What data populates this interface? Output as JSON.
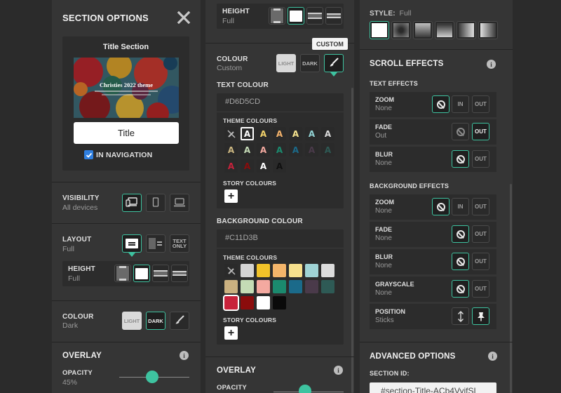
{
  "panel1": {
    "title": "SECTION OPTIONS",
    "preview_caption": "Title Section",
    "preview_image_text": "Christies 2022 theme",
    "title_input_value": "Title",
    "in_navigation_label": "IN NAVIGATION",
    "visibility": {
      "label": "VISIBILITY",
      "value": "All devices"
    },
    "layout": {
      "label": "LAYOUT",
      "value": "Full",
      "text_only_label": "TEXT ONLY"
    },
    "height": {
      "label": "HEIGHT",
      "value": "Full"
    },
    "colour": {
      "label": "COLOUR",
      "value": "Dark",
      "light_label": "LIGHT",
      "dark_label": "DARK"
    },
    "overlay": {
      "title": "OVERLAY",
      "opacity_label": "OPACITY",
      "opacity_value": "45%",
      "opacity_fraction": 0.45
    }
  },
  "panel2": {
    "height": {
      "label": "HEIGHT",
      "value": "Full"
    },
    "colour": {
      "label": "COLOUR",
      "value": "Custom",
      "light_label": "LIGHT",
      "dark_label": "DARK",
      "tooltip": "CUSTOM"
    },
    "text_colour": {
      "label": "TEXT COLOUR",
      "hex": "#D6D5CD",
      "theme_label": "THEME COLOURS",
      "story_label": "STORY COLOURS",
      "glyph": "A",
      "swatch_colors": [
        "#ffffff",
        "#f3d36b",
        "#f5b36b",
        "#f6e48f",
        "#93d4d6",
        "#dcdcdc",
        "#cdb882",
        "#c6dcb8",
        "#f4aaa0",
        "#1b8a6e",
        "#1b6a8a",
        "#4a3a4a",
        "#2e5a55",
        "#c8223b",
        "#8b0c0c",
        "#ffffff",
        "#101010"
      ]
    },
    "background_colour": {
      "label": "BACKGROUND COLOUR",
      "hex": "#C11D3B",
      "theme_label": "THEME COLOURS",
      "story_label": "STORY COLOURS",
      "swatch_colors": [
        "#d4d4d4",
        "#f2c329",
        "#f4b56a",
        "#f7e08d",
        "#9fd3d5",
        "#dcdcdc",
        "#cbb180",
        "#c4dcb5",
        "#f4a9a0",
        "#1b8a6e",
        "#1b6a8a",
        "#4a3a4a",
        "#2e5a55",
        "#c8223b",
        "#8b0c0c",
        "#ffffff",
        "#0a0a0a"
      ]
    },
    "overlay": {
      "title": "OVERLAY",
      "opacity_label": "OPACITY"
    }
  },
  "panel3": {
    "style": {
      "label": "STYLE:",
      "value": "Full"
    },
    "scroll_effects": {
      "title": "SCROLL EFFECTS",
      "text_effects_label": "TEXT EFFECTS",
      "text_effects": [
        {
          "name": "ZOOM",
          "value": "None"
        },
        {
          "name": "FADE",
          "value": "Out"
        },
        {
          "name": "BLUR",
          "value": "None"
        }
      ],
      "background_effects_label": "BACKGROUND EFFECTS",
      "background_effects": [
        {
          "name": "ZOOM",
          "value": "None"
        },
        {
          "name": "FADE",
          "value": "None"
        },
        {
          "name": "BLUR",
          "value": "None"
        },
        {
          "name": "GRAYSCALE",
          "value": "None"
        },
        {
          "name": "POSITION",
          "value": "Sticks"
        }
      ],
      "in_label": "IN",
      "out_label": "OUT"
    },
    "advanced": {
      "title": "ADVANCED OPTIONS",
      "section_id_label": "SECTION ID:",
      "section_id_value": "#section-Title-ACb4VyifSL"
    }
  },
  "colors": {
    "accent": "#3ec3a0",
    "panel": "#353535",
    "background": "#2b2b2b"
  },
  "icons": [
    "close-icon",
    "checkbox-icon",
    "responsive-icon",
    "mobile-icon",
    "desktop-icon",
    "brush-icon",
    "no-entry-icon",
    "vertical-arrows-icon",
    "pin-icon",
    "info-icon",
    "no-colour-icon",
    "plus-icon"
  ]
}
